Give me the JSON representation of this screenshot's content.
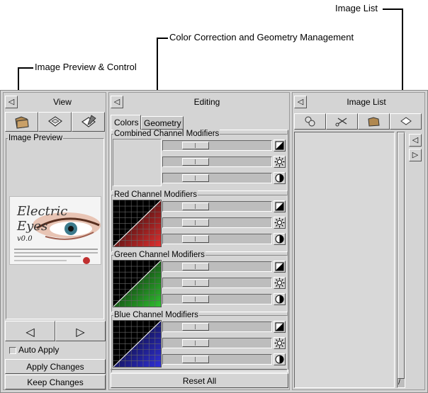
{
  "callouts": {
    "image_list": "Image List",
    "color_geometry": "Color Correction and Geometry Management",
    "preview_control": "Image Preview & Control"
  },
  "view_panel": {
    "title": "View",
    "toolbar_icons": [
      "open-folder-icon",
      "save-disk-icon",
      "save-as-icon"
    ],
    "preview_group_label": "Image Preview",
    "thumbnail": {
      "logo_text": "Electric Eyes",
      "version": "v0.0"
    },
    "prev_button": "◁",
    "next_button": "▷",
    "auto_apply_label": "Auto Apply",
    "apply_changes_label": "Apply Changes",
    "keep_changes_label": "Keep Changes"
  },
  "editing_panel": {
    "title": "Editing",
    "tabs": [
      "Colors",
      "Geometry"
    ],
    "active_tab": "Colors",
    "groups": [
      {
        "label": "Combined Channel Modifiers",
        "channel": "combined"
      },
      {
        "label": "Red Channel Modifiers",
        "channel": "red"
      },
      {
        "label": "Green Channel Modifiers",
        "channel": "green"
      },
      {
        "label": "Blue Channel Modifiers",
        "channel": "blue"
      }
    ],
    "slider_icons": [
      "contrast-icon",
      "brightness-icon",
      "gamma-icon"
    ],
    "reset_all_label": "Reset All"
  },
  "image_list_panel": {
    "title": "Image List",
    "toolbar_icons": [
      "select-icon",
      "cut-icon",
      "open-folder-icon",
      "save-disk-icon"
    ],
    "scroll_left": "◁",
    "scroll_right": "▷"
  },
  "colors": {
    "red": "#e03030",
    "green": "#30c030",
    "blue": "#3030d8",
    "panel_bg": "#d4d4d4"
  }
}
